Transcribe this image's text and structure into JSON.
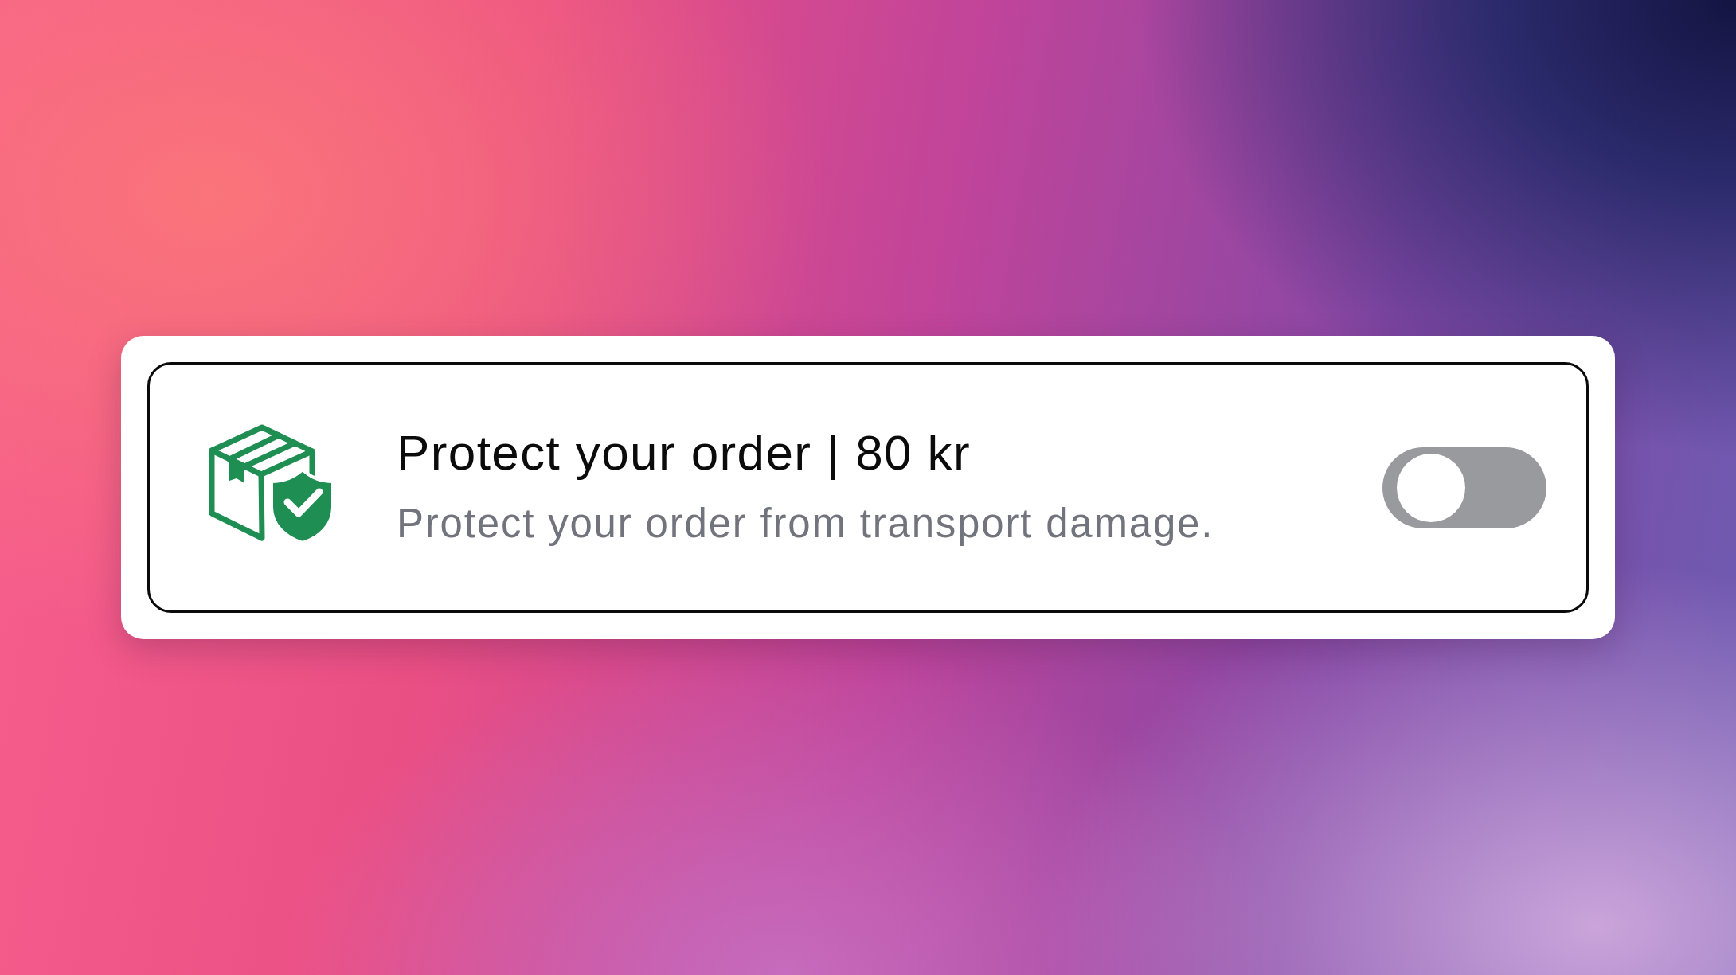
{
  "card": {
    "title": "Protect your order | 80 kr",
    "description": "Protect your order from transport damage.",
    "toggle": {
      "on": false
    }
  }
}
